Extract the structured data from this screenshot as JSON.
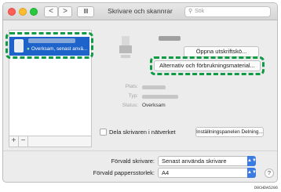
{
  "window": {
    "title": "Skrivare och skannrar"
  },
  "toolbar": {
    "back_glyph": "<",
    "forward_glyph": ">",
    "grid_glyph": "IIII"
  },
  "search": {
    "placeholder": "Sök",
    "icon": "search-icon"
  },
  "printer_list": {
    "items": [
      {
        "status": "Overksam, senast anvä...",
        "selected": true
      }
    ],
    "add_label": "+",
    "remove_label": "−"
  },
  "detail": {
    "open_queue_label": "Öppna utskriftskö...",
    "options_label": "Alternativ och förbrukningsmaterial...",
    "location_label": "Plats:",
    "type_label": "Typ:",
    "status_label": "Status:",
    "status_value": "Overksam",
    "share_label": "Dela skrivaren i nätverket",
    "share_checked": false,
    "share_prefs_label": "Inställningspanelen Delning..."
  },
  "defaults": {
    "default_printer_label": "Förvald skrivare:",
    "default_printer_value": "Senast använda skrivare",
    "paper_size_label": "Förvald pappersstorlek:",
    "paper_size_value": "A4",
    "help_label": "?"
  },
  "footer": {
    "code": "D0CHDA5206"
  },
  "colors": {
    "highlight": "#1d63c9",
    "callout": "#0f9a46",
    "accent": "#3b7ce3"
  }
}
